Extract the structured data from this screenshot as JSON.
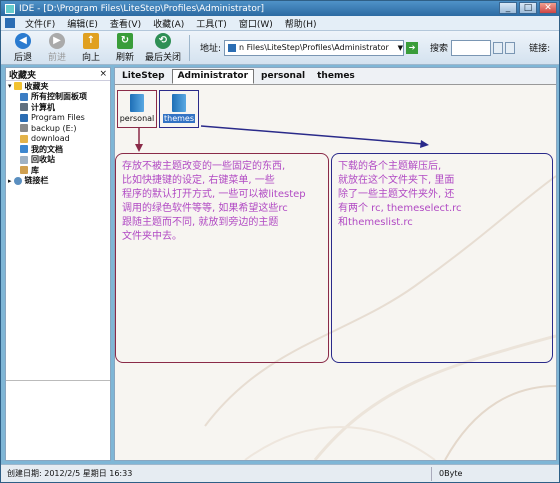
{
  "window": {
    "title": "IDE - [D:\\Program Files\\LiteStep\\Profiles\\Administrator]"
  },
  "window_buttons": {
    "minimize": "_",
    "maximize": "□",
    "close": "✕"
  },
  "menubar": {
    "items": [
      "文件(F)",
      "编辑(E)",
      "查看(V)",
      "收藏(A)",
      "工具(T)",
      "窗口(W)",
      "帮助(H)"
    ]
  },
  "toolbar": {
    "back": "后退",
    "forward": "前进",
    "up": "向上",
    "refresh": "刷新",
    "close_recent": "最后关闭",
    "address_label": "地址:",
    "address_value": "n Files\\LiteStep\\Profiles\\Administrator",
    "search_label": "搜索",
    "links_label": "链接:"
  },
  "sidebar": {
    "title": "收藏夹",
    "close": "×",
    "items": [
      "收藏夹",
      "所有控制面板项",
      "计算机",
      "Program Files",
      "backup (E:)",
      "download",
      "我的文档",
      "回收站",
      "库",
      "链接栏"
    ]
  },
  "tabs": [
    "LiteStep",
    "Administrator",
    "personal",
    "themes"
  ],
  "folders": [
    {
      "label": "personal"
    },
    {
      "label": "themes"
    }
  ],
  "notes": {
    "left": "存放不被主题改变的一些固定的东西,\n比如快捷键的设定, 右键菜单, 一些\n程序的默认打开方式, 一些可以被litestep\n调用的绿色软件等等, 如果希望这些rc\n跟随主题而不同, 就放到旁边的主题\n文件夹中去。",
    "right": "下载的各个主题解压后,\n就放在这个文件夹下, 里面\n除了一些主题文件夹外, 还\n有两个 rc, themeselect.rc\n和themeslist.rc"
  },
  "statusbar": {
    "created": "创建日期: 2012/2/5 星期日 16:33",
    "size": "0Byte"
  },
  "colors": {
    "note_text": "#b14ac4",
    "left_border": "#8a2a48",
    "right_border": "#2a2a8a",
    "selection": "#3373c4"
  }
}
